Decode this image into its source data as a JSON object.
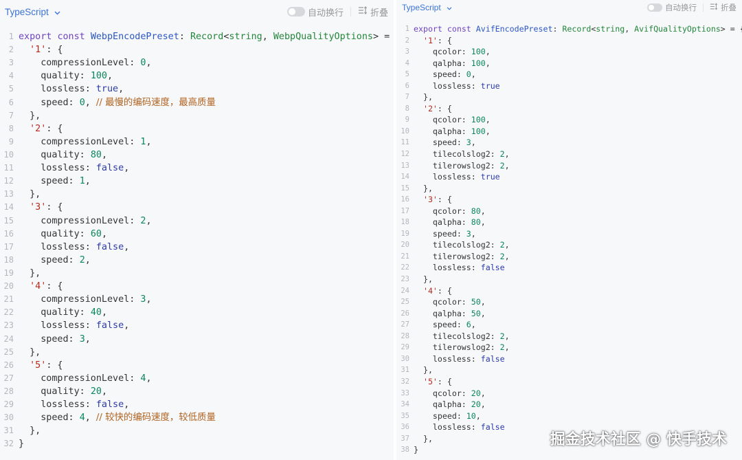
{
  "colors": {
    "accent": "#3b73d6",
    "keyword": "#6f42c1",
    "identifier": "#2a56c6",
    "type": "#22863a",
    "string": "#b52a1d",
    "number": "#098658",
    "boolean": "#2c3aa8",
    "comment": "#b06320",
    "panel_bg": "#f7f8fa"
  },
  "editors": [
    {
      "language": "TypeScript",
      "wrap_label": "自动换行",
      "fold_label": "折叠",
      "wrap_enabled": false,
      "lines": [
        [
          [
            "kw",
            "export"
          ],
          [
            "p",
            " "
          ],
          [
            "kw",
            "const"
          ],
          [
            "p",
            " "
          ],
          [
            "fn",
            "WebpEncodePreset"
          ],
          [
            "p",
            ": "
          ],
          [
            "type",
            "Record"
          ],
          [
            "p",
            "<"
          ],
          [
            "type",
            "string"
          ],
          [
            "p",
            ", "
          ],
          [
            "type",
            "WebpQualityOptions"
          ],
          [
            "p",
            "> = {"
          ]
        ],
        [
          [
            "p",
            "  "
          ],
          [
            "str",
            "'1'"
          ],
          [
            "p",
            ": {"
          ]
        ],
        [
          [
            "p",
            "    compressionLevel: "
          ],
          [
            "num",
            "0"
          ],
          [
            "p",
            ","
          ]
        ],
        [
          [
            "p",
            "    quality: "
          ],
          [
            "num",
            "100"
          ],
          [
            "p",
            ","
          ]
        ],
        [
          [
            "p",
            "    lossless: "
          ],
          [
            "bool",
            "true"
          ],
          [
            "p",
            ","
          ]
        ],
        [
          [
            "p",
            "    speed: "
          ],
          [
            "num",
            "0"
          ],
          [
            "p",
            ", "
          ],
          [
            "cmt",
            "// 最慢的编码速度，最高质量"
          ]
        ],
        [
          [
            "p",
            "  },"
          ]
        ],
        [
          [
            "p",
            "  "
          ],
          [
            "str",
            "'2'"
          ],
          [
            "p",
            ": {"
          ]
        ],
        [
          [
            "p",
            "    compressionLevel: "
          ],
          [
            "num",
            "1"
          ],
          [
            "p",
            ","
          ]
        ],
        [
          [
            "p",
            "    quality: "
          ],
          [
            "num",
            "80"
          ],
          [
            "p",
            ","
          ]
        ],
        [
          [
            "p",
            "    lossless: "
          ],
          [
            "bool",
            "false"
          ],
          [
            "p",
            ","
          ]
        ],
        [
          [
            "p",
            "    speed: "
          ],
          [
            "num",
            "1"
          ],
          [
            "p",
            ","
          ]
        ],
        [
          [
            "p",
            "  },"
          ]
        ],
        [
          [
            "p",
            "  "
          ],
          [
            "str",
            "'3'"
          ],
          [
            "p",
            ": {"
          ]
        ],
        [
          [
            "p",
            "    compressionLevel: "
          ],
          [
            "num",
            "2"
          ],
          [
            "p",
            ","
          ]
        ],
        [
          [
            "p",
            "    quality: "
          ],
          [
            "num",
            "60"
          ],
          [
            "p",
            ","
          ]
        ],
        [
          [
            "p",
            "    lossless: "
          ],
          [
            "bool",
            "false"
          ],
          [
            "p",
            ","
          ]
        ],
        [
          [
            "p",
            "    speed: "
          ],
          [
            "num",
            "2"
          ],
          [
            "p",
            ","
          ]
        ],
        [
          [
            "p",
            "  },"
          ]
        ],
        [
          [
            "p",
            "  "
          ],
          [
            "str",
            "'4'"
          ],
          [
            "p",
            ": {"
          ]
        ],
        [
          [
            "p",
            "    compressionLevel: "
          ],
          [
            "num",
            "3"
          ],
          [
            "p",
            ","
          ]
        ],
        [
          [
            "p",
            "    quality: "
          ],
          [
            "num",
            "40"
          ],
          [
            "p",
            ","
          ]
        ],
        [
          [
            "p",
            "    lossless: "
          ],
          [
            "bool",
            "false"
          ],
          [
            "p",
            ","
          ]
        ],
        [
          [
            "p",
            "    speed: "
          ],
          [
            "num",
            "3"
          ],
          [
            "p",
            ","
          ]
        ],
        [
          [
            "p",
            "  },"
          ]
        ],
        [
          [
            "p",
            "  "
          ],
          [
            "str",
            "'5'"
          ],
          [
            "p",
            ": {"
          ]
        ],
        [
          [
            "p",
            "    compressionLevel: "
          ],
          [
            "num",
            "4"
          ],
          [
            "p",
            ","
          ]
        ],
        [
          [
            "p",
            "    quality: "
          ],
          [
            "num",
            "20"
          ],
          [
            "p",
            ","
          ]
        ],
        [
          [
            "p",
            "    lossless: "
          ],
          [
            "bool",
            "false"
          ],
          [
            "p",
            ","
          ]
        ],
        [
          [
            "p",
            "    speed: "
          ],
          [
            "num",
            "4"
          ],
          [
            "p",
            ", "
          ],
          [
            "cmt",
            "// 较快的编码速度，较低质量"
          ]
        ],
        [
          [
            "p",
            "  },"
          ]
        ],
        [
          [
            "p",
            "}"
          ]
        ]
      ]
    },
    {
      "language": "TypeScript",
      "wrap_label": "自动换行",
      "fold_label": "折叠",
      "wrap_enabled": false,
      "lines": [
        [
          [
            "kw",
            "export"
          ],
          [
            "p",
            " "
          ],
          [
            "kw",
            "const"
          ],
          [
            "p",
            " "
          ],
          [
            "fn",
            "AvifEncodePreset"
          ],
          [
            "p",
            ": "
          ],
          [
            "type",
            "Record"
          ],
          [
            "p",
            "<"
          ],
          [
            "type",
            "string"
          ],
          [
            "p",
            ", "
          ],
          [
            "type",
            "AvifQualityOptions"
          ],
          [
            "p",
            "> = {"
          ]
        ],
        [
          [
            "p",
            "  "
          ],
          [
            "str",
            "'1'"
          ],
          [
            "p",
            ": {"
          ]
        ],
        [
          [
            "p",
            "    qcolor: "
          ],
          [
            "num",
            "100"
          ],
          [
            "p",
            ","
          ]
        ],
        [
          [
            "p",
            "    qalpha: "
          ],
          [
            "num",
            "100"
          ],
          [
            "p",
            ","
          ]
        ],
        [
          [
            "p",
            "    speed: "
          ],
          [
            "num",
            "0"
          ],
          [
            "p",
            ","
          ]
        ],
        [
          [
            "p",
            "    lossless: "
          ],
          [
            "bool",
            "true"
          ]
        ],
        [
          [
            "p",
            "  },"
          ]
        ],
        [
          [
            "p",
            "  "
          ],
          [
            "str",
            "'2'"
          ],
          [
            "p",
            ": {"
          ]
        ],
        [
          [
            "p",
            "    qcolor: "
          ],
          [
            "num",
            "100"
          ],
          [
            "p",
            ","
          ]
        ],
        [
          [
            "p",
            "    qalpha: "
          ],
          [
            "num",
            "100"
          ],
          [
            "p",
            ","
          ]
        ],
        [
          [
            "p",
            "    speed: "
          ],
          [
            "num",
            "3"
          ],
          [
            "p",
            ","
          ]
        ],
        [
          [
            "p",
            "    tilecolslog2: "
          ],
          [
            "num",
            "2"
          ],
          [
            "p",
            ","
          ]
        ],
        [
          [
            "p",
            "    tilerowslog2: "
          ],
          [
            "num",
            "2"
          ],
          [
            "p",
            ","
          ]
        ],
        [
          [
            "p",
            "    lossless: "
          ],
          [
            "bool",
            "true"
          ]
        ],
        [
          [
            "p",
            "  },"
          ]
        ],
        [
          [
            "p",
            "  "
          ],
          [
            "str",
            "'3'"
          ],
          [
            "p",
            ": {"
          ]
        ],
        [
          [
            "p",
            "    qcolor: "
          ],
          [
            "num",
            "80"
          ],
          [
            "p",
            ","
          ]
        ],
        [
          [
            "p",
            "    qalpha: "
          ],
          [
            "num",
            "80"
          ],
          [
            "p",
            ","
          ]
        ],
        [
          [
            "p",
            "    speed: "
          ],
          [
            "num",
            "3"
          ],
          [
            "p",
            ","
          ]
        ],
        [
          [
            "p",
            "    tilecolslog2: "
          ],
          [
            "num",
            "2"
          ],
          [
            "p",
            ","
          ]
        ],
        [
          [
            "p",
            "    tilerowslog2: "
          ],
          [
            "num",
            "2"
          ],
          [
            "p",
            ","
          ]
        ],
        [
          [
            "p",
            "    lossless: "
          ],
          [
            "bool",
            "false"
          ]
        ],
        [
          [
            "p",
            "  },"
          ]
        ],
        [
          [
            "p",
            "  "
          ],
          [
            "str",
            "'4'"
          ],
          [
            "p",
            ": {"
          ]
        ],
        [
          [
            "p",
            "    qcolor: "
          ],
          [
            "num",
            "50"
          ],
          [
            "p",
            ","
          ]
        ],
        [
          [
            "p",
            "    qalpha: "
          ],
          [
            "num",
            "50"
          ],
          [
            "p",
            ","
          ]
        ],
        [
          [
            "p",
            "    speed: "
          ],
          [
            "num",
            "6"
          ],
          [
            "p",
            ","
          ]
        ],
        [
          [
            "p",
            "    tilecolslog2: "
          ],
          [
            "num",
            "2"
          ],
          [
            "p",
            ","
          ]
        ],
        [
          [
            "p",
            "    tilerowslog2: "
          ],
          [
            "num",
            "2"
          ],
          [
            "p",
            ","
          ]
        ],
        [
          [
            "p",
            "    lossless: "
          ],
          [
            "bool",
            "false"
          ]
        ],
        [
          [
            "p",
            "  },"
          ]
        ],
        [
          [
            "p",
            "  "
          ],
          [
            "str",
            "'5'"
          ],
          [
            "p",
            ": {"
          ]
        ],
        [
          [
            "p",
            "    qcolor: "
          ],
          [
            "num",
            "20"
          ],
          [
            "p",
            ","
          ]
        ],
        [
          [
            "p",
            "    qalpha: "
          ],
          [
            "num",
            "20"
          ],
          [
            "p",
            ","
          ]
        ],
        [
          [
            "p",
            "    speed: "
          ],
          [
            "num",
            "10"
          ],
          [
            "p",
            ","
          ]
        ],
        [
          [
            "p",
            "    lossless: "
          ],
          [
            "bool",
            "false"
          ]
        ],
        [
          [
            "p",
            "  },"
          ]
        ],
        [
          [
            "p",
            "}"
          ]
        ]
      ]
    }
  ],
  "watermark": "掘金技术社区 @ 快手技术"
}
